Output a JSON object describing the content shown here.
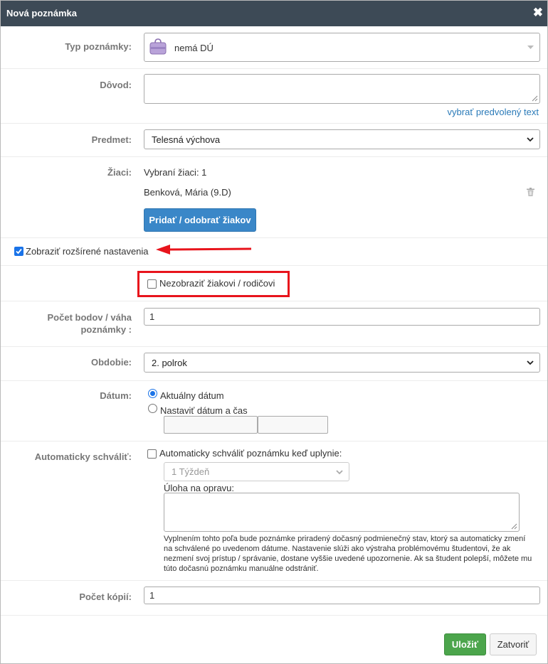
{
  "dialog": {
    "title": "Nová poznámka",
    "close_glyph": "✖"
  },
  "type_row": {
    "label": "Typ poznámky:",
    "value": "nemá DÚ",
    "icon": "purple-bag-icon"
  },
  "reason_row": {
    "label": "Dôvod:",
    "value": "",
    "link": "vybrať predvolený text"
  },
  "subject_row": {
    "label": "Predmet:",
    "value": "Telesná výchova"
  },
  "students_row": {
    "label": "Žiaci:",
    "selected_text": "Vybraní žiaci: 1",
    "student": "Benková, Mária (9.D)",
    "button": "Pridať / odobrať žiakov"
  },
  "advanced": {
    "label": "Zobraziť rozšírené nastavenia",
    "checked": true
  },
  "hide": {
    "label": "Nezobraziť žiakovi / rodičovi",
    "checked": false
  },
  "points_row": {
    "label_line1": "Počet bodov / váha",
    "label_line2": "poznámky :",
    "value": "1"
  },
  "period_row": {
    "label": "Obdobie:",
    "value": "2. polrok"
  },
  "date_row": {
    "label": "Dátum:",
    "option_current": "Aktuálny dátum",
    "option_set": "Nastaviť dátum a čas",
    "selected": "current"
  },
  "auto_row": {
    "label": "Automaticky schváliť:",
    "checkbox_label": "Automaticky schváliť poznámku keď uplynie:",
    "period_value": "1 Týždeň",
    "task_label": "Úloha na opravu:",
    "note": "Vyplnením tohto poľa bude poznámke priradený dočasný podmienečný stav, ktorý sa automaticky zmení na schválené po uvedenom dátume. Nastavenie slúži ako výstraha problémovému študentovi, že ak nezmení svoj prístup / správanie, dostane vyššie uvedené upozornenie. Ak sa študent polepší, môžete mu túto dočasnú poznámku manuálne odstrániť."
  },
  "copies_row": {
    "label": "Počet kópií:",
    "value": "1"
  },
  "footer": {
    "save": "Uložiť",
    "close": "Zatvoriť"
  },
  "colors": {
    "titlebar": "#3d4a56",
    "primary": "#3a87c8",
    "save": "#4ca54c",
    "highlight": "#e8141c"
  }
}
